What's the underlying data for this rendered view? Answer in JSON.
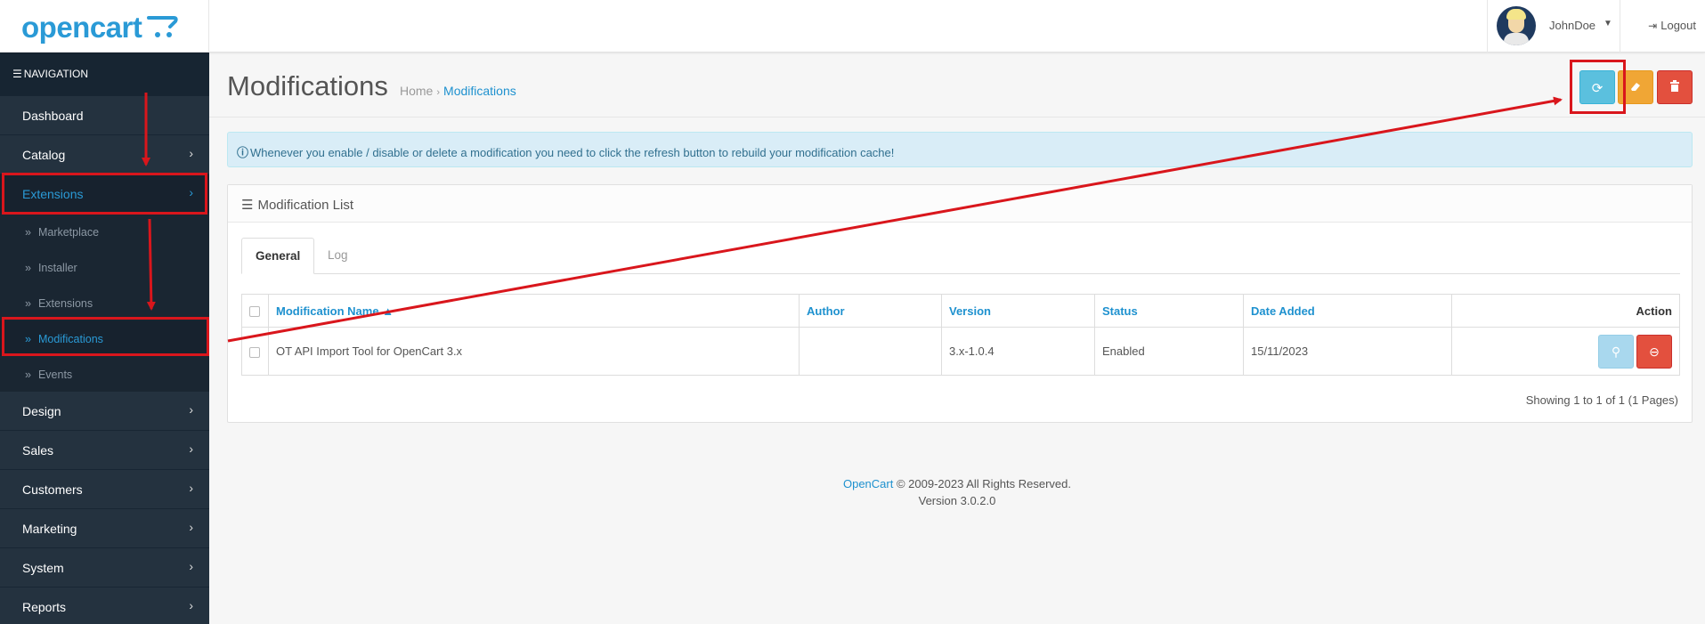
{
  "header": {
    "logo_text": "opencart",
    "username": "JohnDoe",
    "logout_label": "Logout"
  },
  "sidebar": {
    "title": "NAVIGATION",
    "items": [
      {
        "label": "Dashboard"
      },
      {
        "label": "Catalog"
      },
      {
        "label": "Extensions"
      },
      {
        "label": "Design"
      },
      {
        "label": "Sales"
      },
      {
        "label": "Customers"
      },
      {
        "label": "Marketing"
      },
      {
        "label": "System"
      },
      {
        "label": "Reports"
      }
    ],
    "extensions_sub": [
      {
        "label": "Marketplace"
      },
      {
        "label": "Installer"
      },
      {
        "label": "Extensions"
      },
      {
        "label": "Modifications"
      },
      {
        "label": "Events"
      }
    ]
  },
  "page": {
    "title": "Modifications",
    "breadcrumb": [
      "Home",
      "Modifications"
    ],
    "alert": "Whenever you enable / disable or delete a modification you need to click the refresh button to rebuild your modification cache!"
  },
  "panel": {
    "title": "Modification List",
    "tabs": [
      "General",
      "Log"
    ],
    "columns": [
      "Modification Name",
      "Author",
      "Version",
      "Status",
      "Date Added",
      "Action"
    ],
    "rows": [
      {
        "name": "OT API Import Tool for OpenCart 3.x",
        "author": "",
        "version": "3.x-1.0.4",
        "status": "Enabled",
        "date_added": "15/11/2023"
      }
    ],
    "pagination": "Showing 1 to 1 of 1 (1 Pages)"
  },
  "footer": {
    "brand": "OpenCart",
    "copyright": "© 2009-2023 All Rights Reserved.",
    "version": "Version 3.0.2.0"
  },
  "colors": {
    "brand": "#2a9ad6",
    "sidebar": "#1e2d3a",
    "info": "#5bc0de",
    "warning": "#f0a635",
    "danger": "#e3503e",
    "annotation": "#d9161c"
  }
}
